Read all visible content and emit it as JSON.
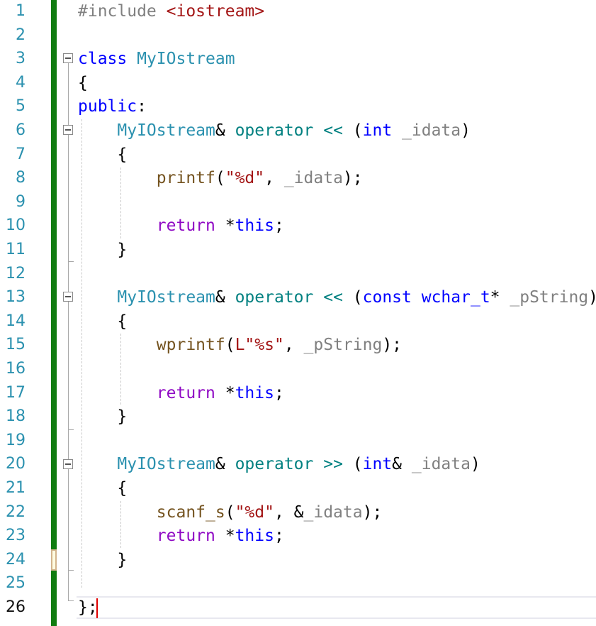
{
  "editor": {
    "lines": [
      {
        "n": "1",
        "tokens": [
          {
            "t": "#include",
            "c": "pre"
          },
          {
            "t": " ",
            "c": "pl"
          },
          {
            "t": "<iostream>",
            "c": "inc"
          }
        ]
      },
      {
        "n": "2",
        "tokens": []
      },
      {
        "n": "3",
        "tokens": [
          {
            "t": "class",
            "c": "kw"
          },
          {
            "t": " ",
            "c": "pl"
          },
          {
            "t": "MyIOstream",
            "c": "ty"
          }
        ]
      },
      {
        "n": "4",
        "tokens": [
          {
            "t": "{",
            "c": "pl"
          }
        ]
      },
      {
        "n": "5",
        "tokens": [
          {
            "t": "public",
            "c": "kw"
          },
          {
            "t": ":",
            "c": "pl"
          }
        ]
      },
      {
        "n": "6",
        "tokens": [
          {
            "t": "    ",
            "c": "pl"
          },
          {
            "t": "MyIOstream",
            "c": "ty"
          },
          {
            "t": "& ",
            "c": "pl"
          },
          {
            "t": "operator",
            "c": "op"
          },
          {
            "t": " ",
            "c": "pl"
          },
          {
            "t": "<<",
            "c": "op"
          },
          {
            "t": " (",
            "c": "pl"
          },
          {
            "t": "int",
            "c": "kw"
          },
          {
            "t": " ",
            "c": "pl"
          },
          {
            "t": "_idata",
            "c": "par"
          },
          {
            "t": ")",
            "c": "pl"
          }
        ]
      },
      {
        "n": "7",
        "tokens": [
          {
            "t": "    {",
            "c": "pl"
          }
        ]
      },
      {
        "n": "8",
        "tokens": [
          {
            "t": "        ",
            "c": "pl"
          },
          {
            "t": "printf",
            "c": "fn"
          },
          {
            "t": "(",
            "c": "pl"
          },
          {
            "t": "\"%d\"",
            "c": "str"
          },
          {
            "t": ", ",
            "c": "pl"
          },
          {
            "t": "_idata",
            "c": "par"
          },
          {
            "t": ");",
            "c": "pl"
          }
        ]
      },
      {
        "n": "9",
        "tokens": []
      },
      {
        "n": "10",
        "tokens": [
          {
            "t": "        ",
            "c": "pl"
          },
          {
            "t": "return",
            "c": "ctl"
          },
          {
            "t": " *",
            "c": "pl"
          },
          {
            "t": "this",
            "c": "kw"
          },
          {
            "t": ";",
            "c": "pl"
          }
        ]
      },
      {
        "n": "11",
        "tokens": [
          {
            "t": "    }",
            "c": "pl"
          }
        ]
      },
      {
        "n": "12",
        "tokens": []
      },
      {
        "n": "13",
        "tokens": [
          {
            "t": "    ",
            "c": "pl"
          },
          {
            "t": "MyIOstream",
            "c": "ty"
          },
          {
            "t": "& ",
            "c": "pl"
          },
          {
            "t": "operator",
            "c": "op"
          },
          {
            "t": " ",
            "c": "pl"
          },
          {
            "t": "<<",
            "c": "op"
          },
          {
            "t": " (",
            "c": "pl"
          },
          {
            "t": "const",
            "c": "kw"
          },
          {
            "t": " ",
            "c": "pl"
          },
          {
            "t": "wchar_t",
            "c": "kw"
          },
          {
            "t": "* ",
            "c": "pl"
          },
          {
            "t": "_pString",
            "c": "par"
          },
          {
            "t": ")",
            "c": "pl"
          }
        ]
      },
      {
        "n": "14",
        "tokens": [
          {
            "t": "    {",
            "c": "pl"
          }
        ]
      },
      {
        "n": "15",
        "tokens": [
          {
            "t": "        ",
            "c": "pl"
          },
          {
            "t": "wprintf",
            "c": "fn"
          },
          {
            "t": "(",
            "c": "pl"
          },
          {
            "t": "L\"%s\"",
            "c": "str"
          },
          {
            "t": ", ",
            "c": "pl"
          },
          {
            "t": "_pString",
            "c": "par"
          },
          {
            "t": ");",
            "c": "pl"
          }
        ]
      },
      {
        "n": "16",
        "tokens": []
      },
      {
        "n": "17",
        "tokens": [
          {
            "t": "        ",
            "c": "pl"
          },
          {
            "t": "return",
            "c": "ctl"
          },
          {
            "t": " *",
            "c": "pl"
          },
          {
            "t": "this",
            "c": "kw"
          },
          {
            "t": ";",
            "c": "pl"
          }
        ]
      },
      {
        "n": "18",
        "tokens": [
          {
            "t": "    }",
            "c": "pl"
          }
        ]
      },
      {
        "n": "19",
        "tokens": []
      },
      {
        "n": "20",
        "tokens": [
          {
            "t": "    ",
            "c": "pl"
          },
          {
            "t": "MyIOstream",
            "c": "ty"
          },
          {
            "t": "& ",
            "c": "pl"
          },
          {
            "t": "operator",
            "c": "op"
          },
          {
            "t": " ",
            "c": "pl"
          },
          {
            "t": ">>",
            "c": "op"
          },
          {
            "t": " (",
            "c": "pl"
          },
          {
            "t": "int",
            "c": "kw"
          },
          {
            "t": "& ",
            "c": "pl"
          },
          {
            "t": "_idata",
            "c": "par"
          },
          {
            "t": ")",
            "c": "pl"
          }
        ]
      },
      {
        "n": "21",
        "tokens": [
          {
            "t": "    {",
            "c": "pl"
          }
        ]
      },
      {
        "n": "22",
        "tokens": [
          {
            "t": "        ",
            "c": "pl"
          },
          {
            "t": "scanf_s",
            "c": "fn"
          },
          {
            "t": "(",
            "c": "pl"
          },
          {
            "t": "\"%d\"",
            "c": "str"
          },
          {
            "t": ", &",
            "c": "pl"
          },
          {
            "t": "_idata",
            "c": "par"
          },
          {
            "t": ");",
            "c": "pl"
          }
        ]
      },
      {
        "n": "23",
        "tokens": [
          {
            "t": "        ",
            "c": "pl"
          },
          {
            "t": "return",
            "c": "ctl"
          },
          {
            "t": " *",
            "c": "pl"
          },
          {
            "t": "this",
            "c": "kw"
          },
          {
            "t": ";",
            "c": "pl"
          }
        ]
      },
      {
        "n": "24",
        "tokens": [
          {
            "t": "    }",
            "c": "pl"
          }
        ]
      },
      {
        "n": "25",
        "tokens": []
      },
      {
        "n": "26",
        "tokens": [
          {
            "t": "};",
            "c": "pl"
          }
        ]
      }
    ],
    "current_line": "26",
    "colors": {
      "line_number": "#2b91af",
      "keyword": "#0000ff",
      "type": "#2b91af",
      "control_keyword": "#8f08c4",
      "function": "#74531f",
      "string": "#a31515",
      "parameter": "#808080",
      "operator": "#008080",
      "change_bar": "#107c10",
      "caret": "#e00000"
    }
  }
}
